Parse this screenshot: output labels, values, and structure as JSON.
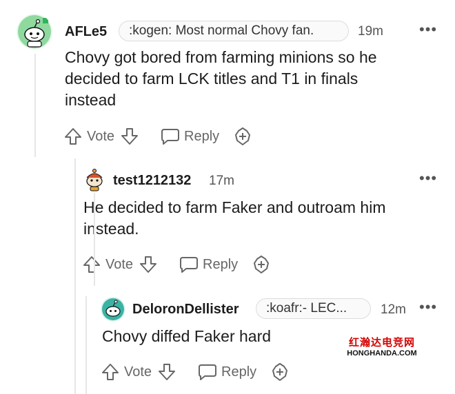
{
  "comments": [
    {
      "username": "AFLe5",
      "flair": ":kogen: Most normal Chovy fan.",
      "time": "19m",
      "more": "•••",
      "body_lines": [
        "Chovy got bored from farming minions so he",
        "decided to farm LCK titles and T1 in finals",
        "instead"
      ],
      "vote_label": "Vote",
      "reply_label": "Reply"
    },
    {
      "username": "test1212132",
      "time": "17m",
      "more": "•••",
      "body_lines": [
        "He decided to farm Faker and outroam him",
        "instead."
      ],
      "vote_label": "Vote",
      "reply_label": "Reply"
    },
    {
      "username": "DeloronDellister",
      "flair": ":koafr:- LEC...",
      "time": "12m",
      "more": "•••",
      "body_lines": [
        "Chovy diffed Faker hard"
      ],
      "vote_label": "Vote",
      "reply_label": "Reply"
    }
  ],
  "watermark": {
    "line1": "红瀚达电竞网",
    "line2": "HONGHANDA.COM"
  },
  "colors": {
    "text": "#1c1c1c",
    "muted": "#666666",
    "thread_line": "#e6e6e6",
    "avatar_green": "#2fb45a",
    "avatar_teal": "#3bb3a4"
  }
}
